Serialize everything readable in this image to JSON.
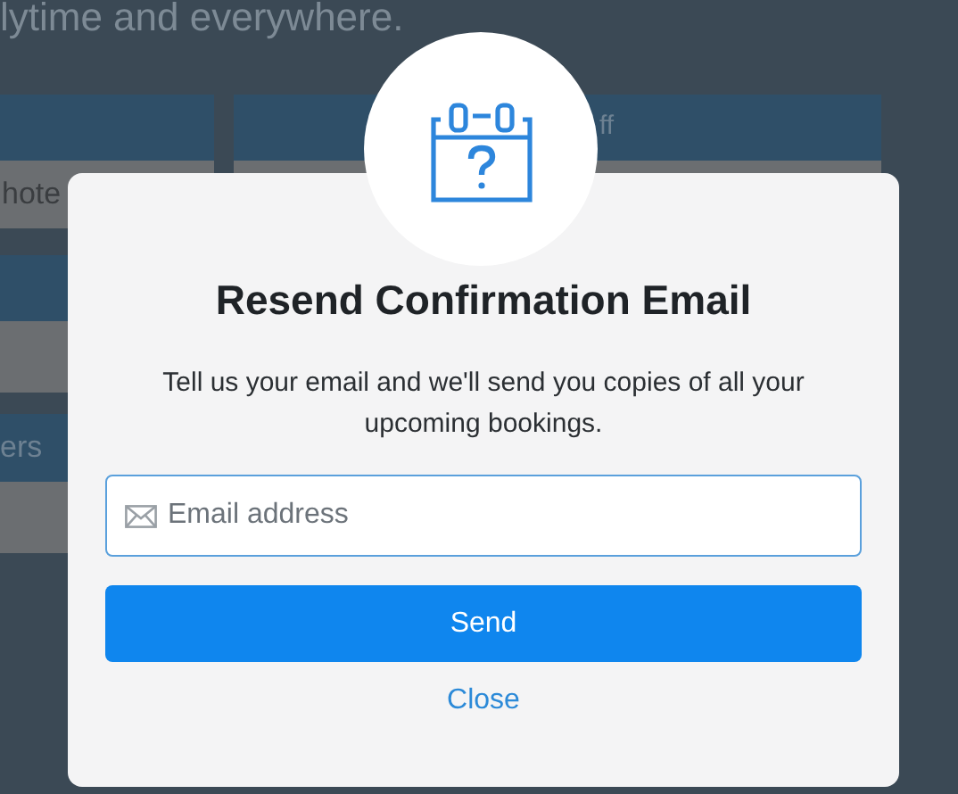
{
  "background": {
    "headline": "lytime and everywhere.",
    "tab_label": "ff",
    "field_text": "hote",
    "section_label": "ers"
  },
  "dialog": {
    "title": "Resend Confirmation Email",
    "message": "Tell us your email and we'll send you copies of all your upcoming bookings.",
    "email_field": {
      "placeholder": "Email address"
    },
    "send_button": "Send",
    "close_link": "Close"
  }
}
